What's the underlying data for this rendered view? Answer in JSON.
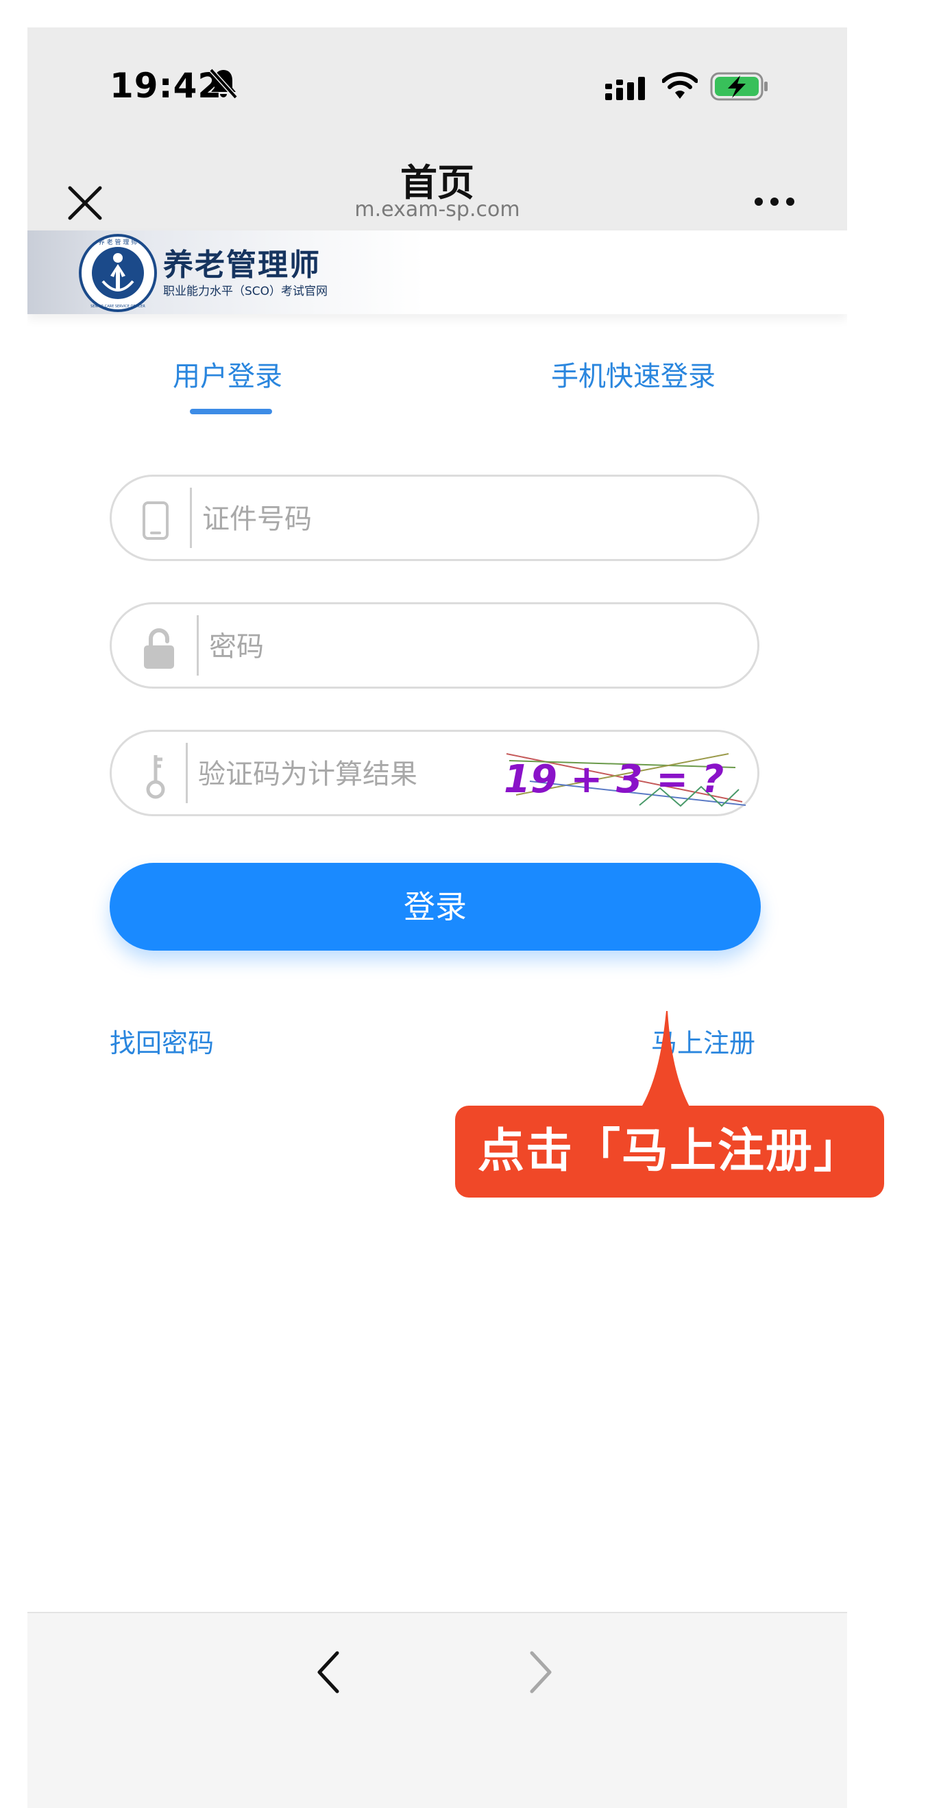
{
  "status_bar": {
    "time": "19:42"
  },
  "nav": {
    "title": "首页",
    "url": "m.exam-sp.com"
  },
  "banner": {
    "title": "养老管理师",
    "subtitle": "职业能力水平（SCO）考试官网",
    "emblem_text": "养 老 管 理 师",
    "emblem_ring_text": "SENIOR CARE SERVICE OFFICER"
  },
  "tabs": [
    {
      "label": "用户登录",
      "active": true
    },
    {
      "label": "手机快速登录",
      "active": false
    }
  ],
  "form": {
    "id_placeholder": "证件号码",
    "password_placeholder": "密码",
    "captcha_placeholder": "验证码为计算结果",
    "captcha_text": "19 + 3 = ?",
    "login_label": "登录"
  },
  "links": {
    "forgot": "找回密码",
    "register": "马上注册"
  },
  "annotation": {
    "text": "点击「马上注册」"
  },
  "colors": {
    "primary": "#1a8aff",
    "link": "#2a86de",
    "annotation": "#f04828",
    "captcha": "#8a12c8"
  }
}
